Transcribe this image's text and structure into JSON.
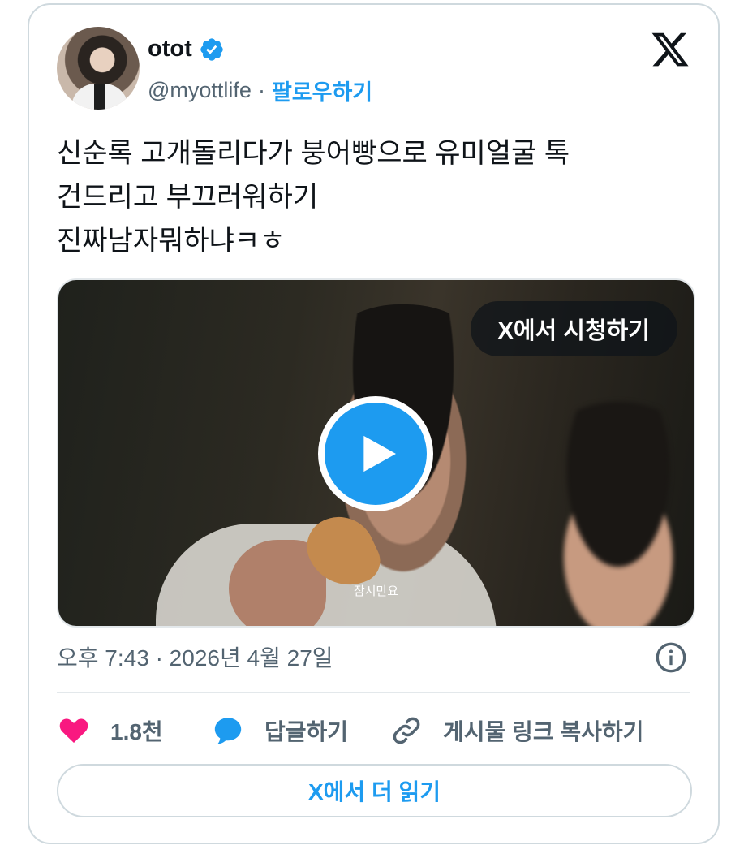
{
  "author": {
    "name": "otot",
    "handle": "@myottlife",
    "separator": "·",
    "follow_label": "팔로우하기",
    "verified": true
  },
  "tweet": {
    "lines": [
      "신순록 고개돌리다가 붕어빵으로 유미얼굴 톡",
      "건드리고 부끄러워하기",
      "진짜남자뭐하냐ㅋㅎ"
    ]
  },
  "media": {
    "watch_label": "X에서 시청하기",
    "subtitle": "잠시만요"
  },
  "timestamp": "오후 7:43 · 2026년 4월 27일",
  "actions": {
    "likes": "1.8천",
    "reply_label": "답글하기",
    "copy_link_label": "게시물 링크 복사하기"
  },
  "read_more_label": "X에서 더 읽기",
  "colors": {
    "accent": "#1d9bf0",
    "like": "#f91880",
    "text": "#0f1419",
    "muted": "#536471",
    "border": "#cfd9de"
  },
  "icons": [
    "verified-badge-icon",
    "x-logo-icon",
    "play-icon",
    "info-icon",
    "heart-icon",
    "reply-bubble-icon",
    "link-icon"
  ]
}
